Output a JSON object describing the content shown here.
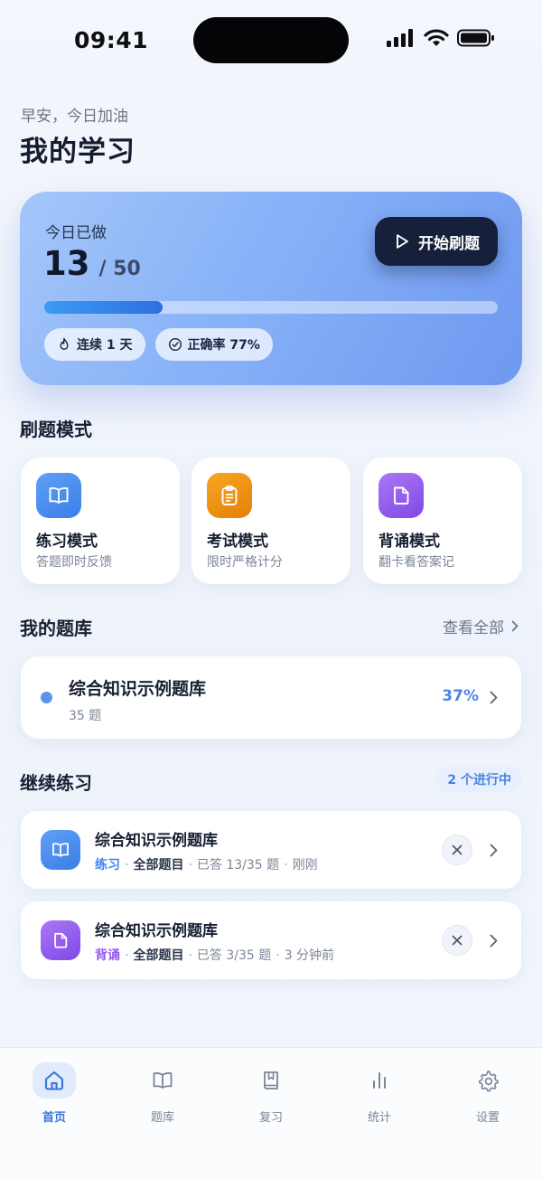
{
  "status_bar": {
    "time": "09:41"
  },
  "header": {
    "greeting": "早安，今日加油",
    "title": "我的学习"
  },
  "hero": {
    "label": "今日已做",
    "done": "13",
    "total": "/ 50",
    "progress": 0.26,
    "start_label": "开始刷题",
    "streak_label": "连续 1 天",
    "accuracy_label": "正确率 77%"
  },
  "modes": {
    "title": "刷题模式",
    "items": [
      {
        "name": "练习模式",
        "desc": "答题即时反馈",
        "icon": "book-open-icon",
        "color": "#3f86f0"
      },
      {
        "name": "考试模式",
        "desc": "限时严格计分",
        "icon": "clipboard-icon",
        "color": "#ee8a0c"
      },
      {
        "name": "背诵模式",
        "desc": "翻卡看答案记",
        "icon": "note-icon",
        "color": "#9158ee"
      }
    ]
  },
  "banks": {
    "title": "我的题库",
    "view_all": "查看全部",
    "items": [
      {
        "name": "综合知识示例题库",
        "count": "35 题",
        "percent": "37%",
        "dot_color": "#5b94ea"
      }
    ]
  },
  "continue": {
    "title": "继续练习",
    "badge": "2 个进行中",
    "items": [
      {
        "title": "综合知识示例题库",
        "mode": "练习",
        "mode_color": "#3f86f0",
        "scope": "全部题目",
        "answered": "已答 13/35 题",
        "time": "刚刚",
        "icon": "book-open-icon"
      },
      {
        "title": "综合知识示例题库",
        "mode": "背诵",
        "mode_color": "#9158ee",
        "scope": "全部题目",
        "answered": "已答 3/35 题",
        "time": "3 分钟前",
        "icon": "note-icon"
      }
    ]
  },
  "tabs": [
    {
      "label": "首页",
      "icon": "home-icon",
      "active": true
    },
    {
      "label": "题库",
      "icon": "book-open-icon",
      "active": false
    },
    {
      "label": "复习",
      "icon": "bookmark-book-icon",
      "active": false
    },
    {
      "label": "统计",
      "icon": "bar-chart-icon",
      "active": false
    },
    {
      "label": "设置",
      "icon": "gear-icon",
      "active": false
    }
  ]
}
